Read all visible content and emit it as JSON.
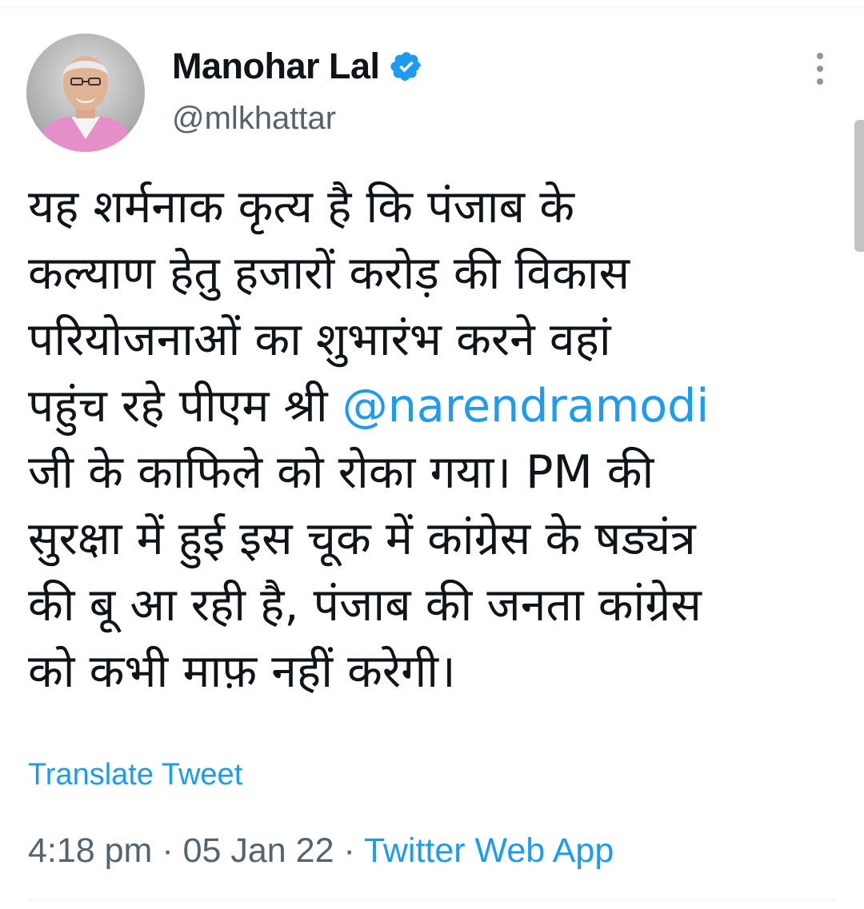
{
  "author": {
    "display_name": "Manohar Lal",
    "handle": "@mlkhattar",
    "verified": true
  },
  "tweet": {
    "lines": [
      "यह शर्मनाक कृत्य है कि पंजाब के",
      "कल्याण हेतु हजारों करोड़ की विकास",
      "परियोजनाओं का शुभारंभ करने वहां",
      "पहुंच रहे पीएम श्री ",
      "जी के काफिले को रोका गया। PM की",
      "सुरक्षा में हुई इस चूक में कांग्रेस के षड्यंत्र",
      "की बू आ रही है, पंजाब की जनता कांग्रेस",
      "को कभी माफ़ नहीं करेगी।"
    ],
    "mention": "@narendramodi"
  },
  "translate_label": "Translate Tweet",
  "meta": {
    "time": "4:18 pm",
    "separator": "·",
    "date": "05 Jan 22",
    "source": "Twitter Web App"
  },
  "icons": {
    "verified": "verified-badge-icon",
    "more": "more-options-icon"
  },
  "colors": {
    "link": "#1d9bf0",
    "text": "#0f1419",
    "secondary": "#536471"
  }
}
